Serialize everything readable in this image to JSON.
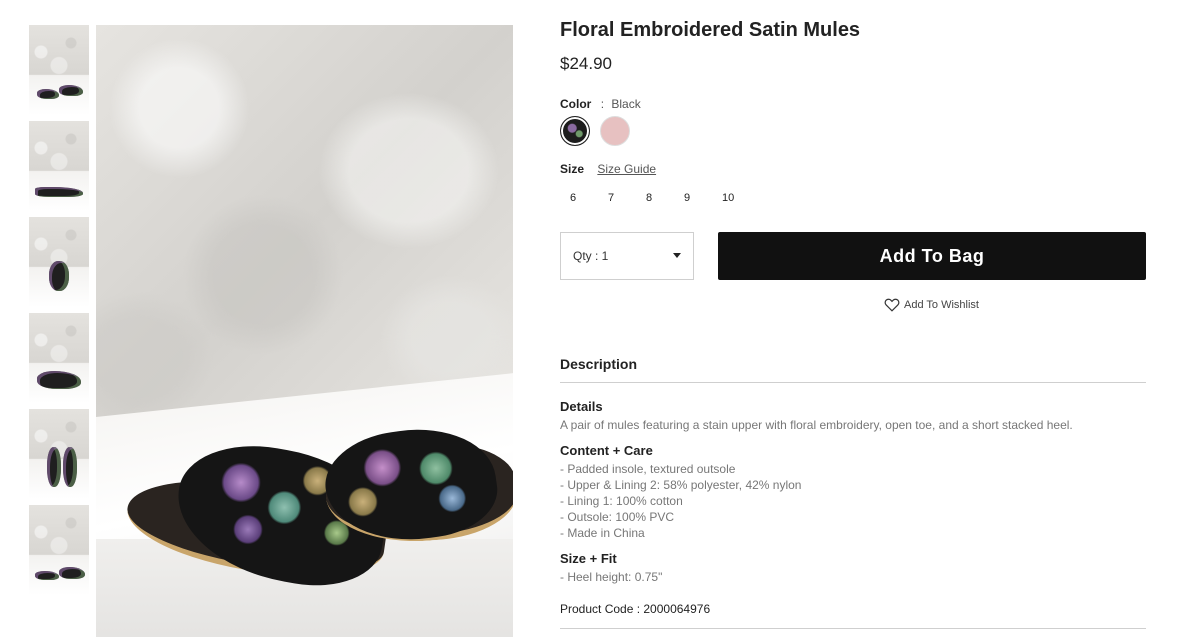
{
  "product": {
    "title": "Floral Embroidered Satin Mules",
    "price": "$24.90"
  },
  "color": {
    "label": "Color",
    "separator": ":",
    "selected": "Black",
    "swatches": [
      {
        "name": "Black",
        "hex": "#1c1c1c"
      },
      {
        "name": "Pink",
        "hex": "#e7c1c1"
      }
    ]
  },
  "size": {
    "label": "Size",
    "guide_link": "Size Guide",
    "options": [
      "6",
      "7",
      "8",
      "9",
      "10"
    ]
  },
  "quantity": {
    "label": "Qty : 1"
  },
  "actions": {
    "add_to_bag": "Add To Bag",
    "add_to_wishlist": "Add To Wishlist"
  },
  "description": {
    "heading": "Description",
    "details_heading": "Details",
    "details_text": "A pair of mules featuring a stain upper with floral embroidery, open toe, and a short stacked heel.",
    "content_heading": "Content + Care",
    "content_items": [
      "- Padded insole, textured outsole",
      "- Upper & Lining 2: 58% polyester, 42% nylon",
      "- Lining 1: 100% cotton",
      "- Outsole: 100% PVC",
      "- Made in China"
    ],
    "fit_heading": "Size + Fit",
    "fit_items": [
      "- Heel height: 0.75\""
    ],
    "product_code": "Product Code : 2000064976"
  },
  "colors": {
    "button_bg": "#111111",
    "button_text": "#ffffff",
    "muted_text": "#777777"
  }
}
